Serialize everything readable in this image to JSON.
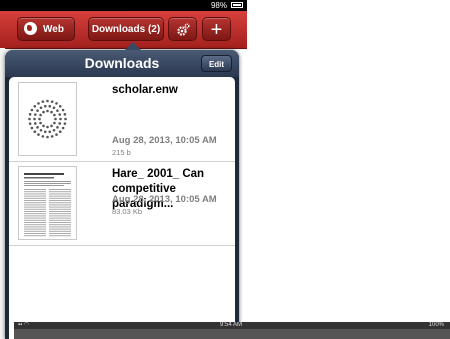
{
  "status_bar": {
    "battery_text": "98%"
  },
  "toolbar": {
    "web_label": "Web",
    "downloads_label": "Downloads (2)",
    "settings_icon": "gear-icon",
    "add_label": "+"
  },
  "panel": {
    "title": "Downloads",
    "edit_label": "Edit",
    "items": [
      {
        "name": "scholar.enw",
        "date": "Aug 28, 2013, 10:05 AM",
        "size": "215 b"
      },
      {
        "name": "Hare_ 2001_ Can competitive paradigm...",
        "date": "Aug 28, 2013, 10:05 AM",
        "size": "83.03 Kb"
      }
    ]
  },
  "background_window": {
    "time": "9:54 AM",
    "battery": "100%"
  },
  "colors": {
    "accent": "#c0302c",
    "panel": "#1e2a3c"
  }
}
